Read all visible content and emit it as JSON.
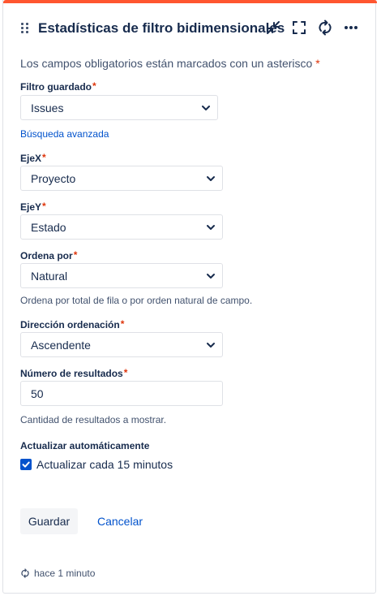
{
  "colors": {
    "accent_bar": "#ff5630",
    "primary": "#0052cc",
    "required": "#de350b"
  },
  "header": {
    "title": "Estadísticas de filtro bidimensionales",
    "icons": [
      "drag-handle-icon",
      "minimize-icon",
      "fullscreen-icon",
      "refresh-icon",
      "more-icon"
    ]
  },
  "form": {
    "required_note": "Los campos obligatorios están marcados con un asterisco",
    "required_mark": "*",
    "saved_filter": {
      "label": "Filtro guardado",
      "value": "Issues"
    },
    "advanced_search": "Búsqueda avanzada",
    "x_axis": {
      "label": "EjeX",
      "value": "Proyecto"
    },
    "y_axis": {
      "label": "EjeY",
      "value": "Estado"
    },
    "sort_by": {
      "label": "Ordena por",
      "value": "Natural",
      "help": "Ordena por total de fila o por orden natural de campo."
    },
    "sort_direction": {
      "label": "Dirección ordenación",
      "value": "Ascendente"
    },
    "num_results": {
      "label": "Número de resultados",
      "value": "50",
      "help": "Cantidad de resultados a mostrar."
    },
    "auto_refresh": {
      "label": "Actualizar automáticamente",
      "checkbox_label": "Actualizar cada 15 minutos",
      "checked": true
    }
  },
  "actions": {
    "save": "Guardar",
    "cancel": "Cancelar"
  },
  "footer": {
    "updated": "hace 1 minuto"
  }
}
